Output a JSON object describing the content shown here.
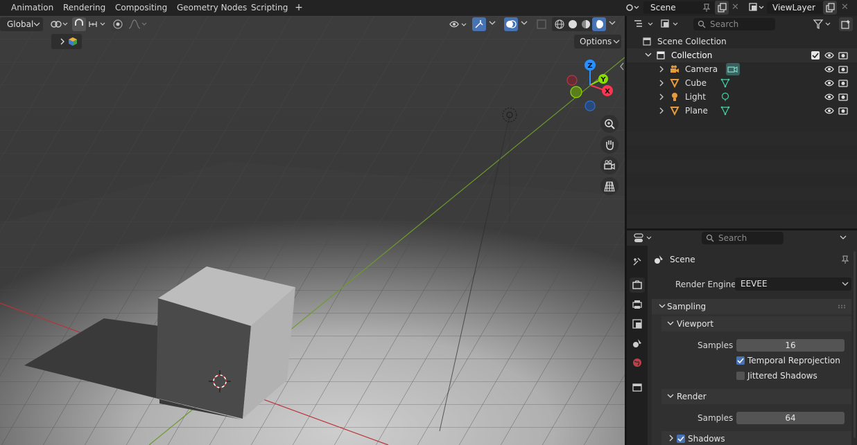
{
  "topbar": {
    "tabs": [
      "Animation",
      "Rendering",
      "Compositing",
      "Geometry Nodes",
      "Scripting"
    ],
    "add_tab": "+",
    "scene_name": "Scene",
    "viewlayer_name": "ViewLayer"
  },
  "viewport": {
    "orientation": "Global",
    "options_label": "Options",
    "gizmo": {
      "z": "Z",
      "y": "Y",
      "x": "X"
    }
  },
  "outliner": {
    "search_placeholder": "Search",
    "scene_collection": "Scene Collection",
    "collection": "Collection",
    "items": [
      {
        "name": "Camera",
        "icon": "camera-icon"
      },
      {
        "name": "Cube",
        "icon": "mesh-icon"
      },
      {
        "name": "Light",
        "icon": "light-icon"
      },
      {
        "name": "Plane",
        "icon": "mesh-icon"
      }
    ]
  },
  "properties": {
    "search_placeholder": "Search",
    "context": "Scene",
    "render_engine_label": "Render Engine",
    "render_engine_value": "EEVEE",
    "sampling_label": "Sampling",
    "viewport_label": "Viewport",
    "viewport_samples_label": "Samples",
    "viewport_samples": "16",
    "temporal_reprojection": "Temporal Reprojection",
    "temporal_reprojection_checked": true,
    "jittered_shadows": "Jittered Shadows",
    "jittered_shadows_checked": false,
    "render_label": "Render",
    "render_samples_label": "Samples",
    "render_samples": "64",
    "shadows_label": "Shadows",
    "shadows_checked": true
  },
  "colors": {
    "accent": "#4772b3",
    "x_axis": "#ff3352",
    "y_axis": "#8bdc00",
    "z_axis": "#2890ff"
  }
}
